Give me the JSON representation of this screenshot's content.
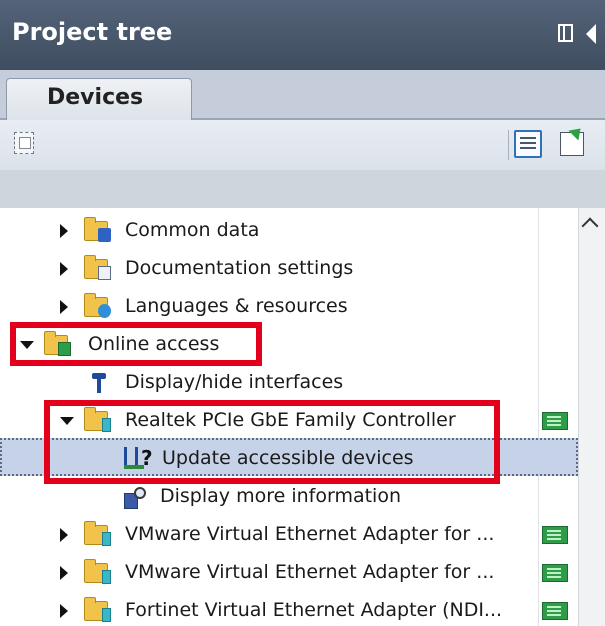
{
  "header": {
    "title": "Project tree"
  },
  "tabs": [
    {
      "label": "Devices"
    }
  ],
  "colors": {
    "highlight": "#e3001b",
    "header_bg": "#4b596d",
    "selected_row": "#c5d2e8"
  },
  "tree": {
    "items": [
      {
        "label": "Common data",
        "icon": "common-data-icon",
        "state": "collapsed"
      },
      {
        "label": "Documentation settings",
        "icon": "documentation-icon",
        "state": "collapsed"
      },
      {
        "label": "Languages & resources",
        "icon": "languages-icon",
        "state": "collapsed"
      },
      {
        "label": "Online access",
        "icon": "online-access-icon",
        "state": "expanded"
      },
      {
        "label": "Display/hide interfaces",
        "icon": "interface-icon",
        "state": "leaf"
      },
      {
        "label": "Realtek PCIe GbE Family Controller",
        "icon": "network-adapter-folder-icon",
        "state": "expanded"
      },
      {
        "label": "Update accessible devices",
        "icon": "update-devices-icon",
        "state": "leaf-selected"
      },
      {
        "label": "Display more information",
        "icon": "info-icon",
        "state": "leaf"
      },
      {
        "label": "VMware Virtual Ethernet Adapter for ...",
        "icon": "network-adapter-folder-icon",
        "state": "collapsed"
      },
      {
        "label": "VMware Virtual Ethernet Adapter for ...",
        "icon": "network-adapter-folder-icon",
        "state": "collapsed"
      },
      {
        "label": "Fortinet Virtual Ethernet Adapter (NDI...",
        "icon": "network-adapter-folder-icon",
        "state": "collapsed"
      }
    ]
  }
}
